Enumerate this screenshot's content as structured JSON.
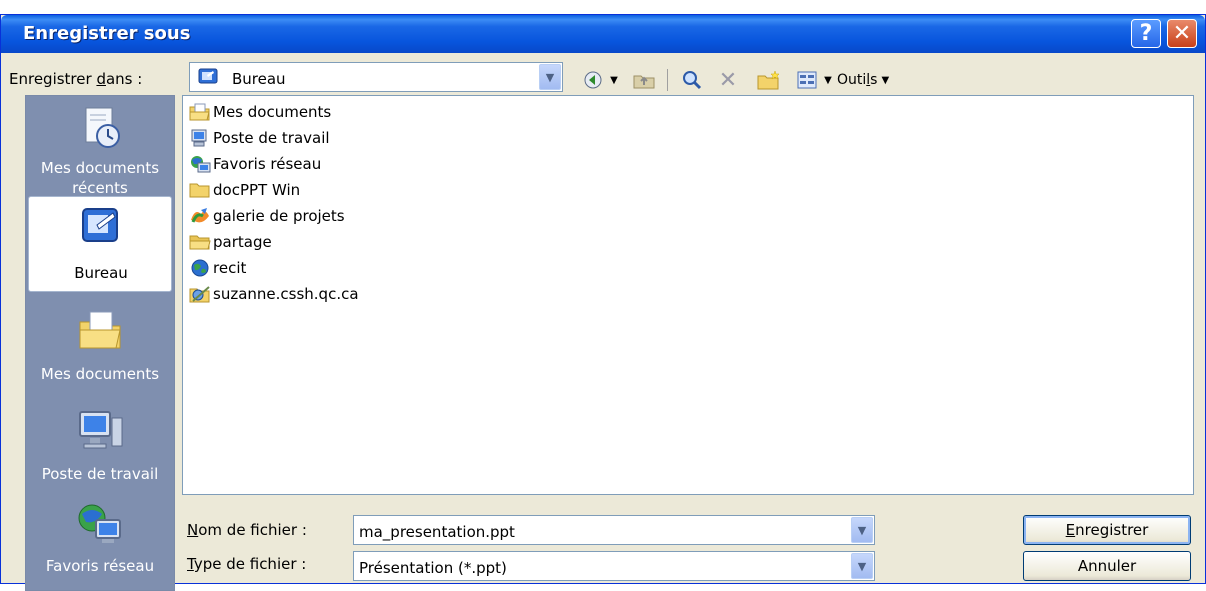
{
  "window": {
    "title": "Enregistrer sous",
    "help_label": "?",
    "close_label": "✕"
  },
  "save_in": {
    "label_pre": "Enregistrer ",
    "label_accel": "d",
    "label_post": "ans :",
    "value": "Bureau"
  },
  "toolbar": {
    "back_icon": "back-icon",
    "up_icon": "up-folder-icon",
    "search_icon": "search-web-icon",
    "delete_icon": "delete-icon",
    "new_folder_icon": "new-folder-icon",
    "views_icon": "views-icon",
    "tools_pre": "Outi",
    "tools_accel": "l",
    "tools_post": "s"
  },
  "places": [
    {
      "label_line1": "Mes documents",
      "label_line2": "récents",
      "icon": "recent-documents-icon"
    },
    {
      "label_line1": "Bureau",
      "label_line2": "",
      "icon": "desktop-icon",
      "selected": true
    },
    {
      "label_line1": "Mes documents",
      "label_line2": "",
      "icon": "my-documents-icon"
    },
    {
      "label_line1": "Poste de travail",
      "label_line2": "",
      "icon": "my-computer-icon"
    },
    {
      "label_line1": "Favoris réseau",
      "label_line2": "",
      "icon": "network-places-icon"
    }
  ],
  "files": [
    {
      "name": "Mes documents",
      "icon": "documents-folder-icon"
    },
    {
      "name": "Poste de travail",
      "icon": "computer-icon"
    },
    {
      "name": "Favoris réseau",
      "icon": "network-icon"
    },
    {
      "name": "docPPT Win",
      "icon": "folder-icon"
    },
    {
      "name": "galerie de projets",
      "icon": "shortcut-icon"
    },
    {
      "name": "partage",
      "icon": "open-folder-icon"
    },
    {
      "name": "recit",
      "icon": "globe-icon"
    },
    {
      "name": "suzanne.cssh.qc.ca",
      "icon": "ftp-icon"
    }
  ],
  "filename": {
    "label_accel": "N",
    "label_post": "om de fichier :",
    "value": "ma_presentation.ppt"
  },
  "filetype": {
    "label_accel": "T",
    "label_post": "ype de fichier :",
    "value": "Présentation (*.ppt)"
  },
  "buttons": {
    "save_accel": "E",
    "save_post": "nregistrer",
    "cancel": "Annuler"
  },
  "colors": {
    "titlebar": "#0855dd",
    "dialog_bg": "#ece9d8",
    "places_bg": "#7f8faf"
  }
}
